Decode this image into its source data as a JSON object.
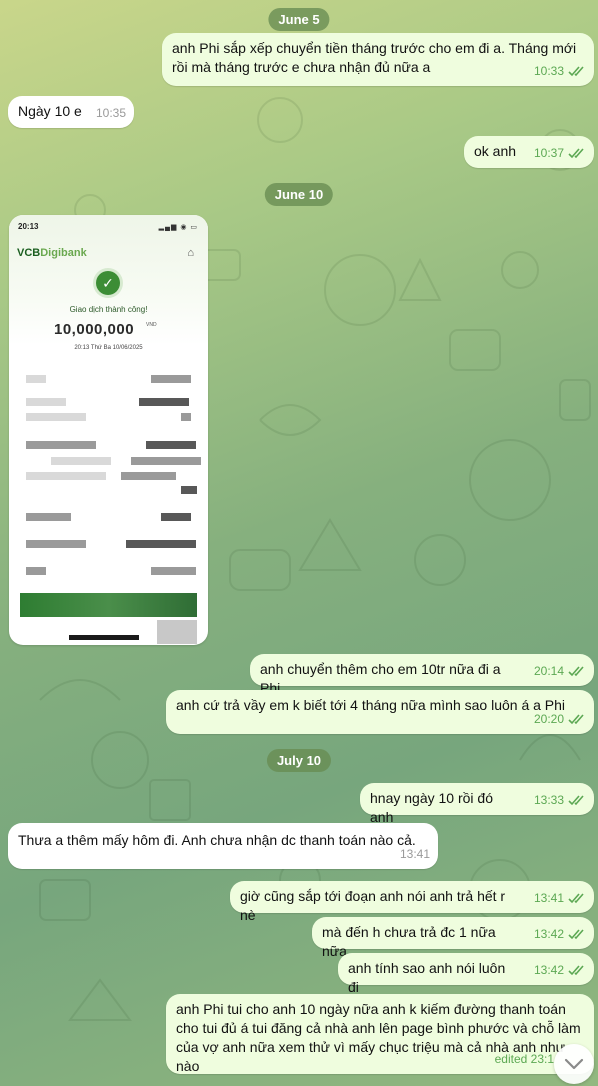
{
  "dates": [
    "June 5",
    "June 10",
    "July 10"
  ],
  "messages": [
    {
      "text": "anh Phi sắp xếp chuyển tiền tháng trước cho em đi a. Tháng mới rồi mà tháng trước e chưa nhận đủ nữa a",
      "time": "10:33"
    },
    {
      "text": "Ngày 10 e",
      "time": "10:35"
    },
    {
      "text": "ok anh",
      "time": "10:37"
    },
    {
      "text": "anh chuyển thêm cho em 10tr nữa đi a Phi",
      "time": "20:14"
    },
    {
      "text": "anh cứ trả vầy em k biết tới 4 tháng nữa mình sao luôn á a Phi",
      "time": "20:20"
    },
    {
      "text": "hnay ngày 10 rồi đó anh",
      "time": "13:33"
    },
    {
      "text": "Thưa a thêm mấy hôm đi. Anh chưa nhận dc thanh toán nào cả.",
      "time": "13:41"
    },
    {
      "text": "giờ cũng sắp tới đoạn anh nói anh trả hết r nè",
      "time": "13:41"
    },
    {
      "text": "mà đến h chưa trả đc 1 nữa nữa",
      "time": "13:42"
    },
    {
      "text": "anh tính sao anh nói luôn đi",
      "time": "13:42"
    },
    {
      "text": "anh Phi tui cho anh 10 ngày nữa anh k kiếm đường thanh toán cho tui đủ á tui đăng cả nhà anh lên page bình phước và chỗ làm của vợ anh nữa xem thử vì mấy chục triệu mà cả nhà anh như nào",
      "time": "edited 23:1"
    }
  ],
  "receipt": {
    "status_time": "20:13",
    "brand_vcb": "VCB",
    "brand_digi": "Digibank",
    "success": "Giao dịch thành công!",
    "amount": "10,000,000",
    "currency": "VND",
    "datetime": "20:13 Thứ Ba 10/06/2025"
  },
  "colors": {
    "outgoing": "#effdde",
    "incoming": "#ffffff",
    "time_out": "#5ca853",
    "date_pill": "#688c52"
  },
  "icons": {
    "read": "double-check-icon",
    "scroll": "chevron-down-icon",
    "home": "home-icon",
    "check": "check-circle-icon"
  }
}
